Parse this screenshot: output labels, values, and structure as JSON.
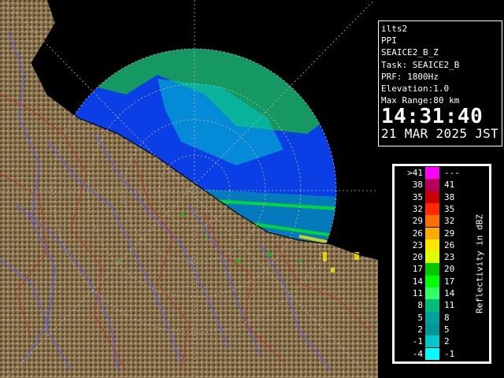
{
  "radar": {
    "station_id": "ilts2",
    "display_mode": "PPI",
    "product": "SEAICE2_B_Z",
    "task_label": "Task: SEAICE2_B",
    "prf_label": "PRF: 1800Hz",
    "elevation_label": "Elevation:1.0",
    "max_range_label": "Max Range:80 km",
    "time": "14:31:40",
    "date": "21 MAR 2025 JST"
  },
  "legend": {
    "title": "Reflectivity in dBZ",
    "rows": [
      {
        "lo": ">41",
        "hi": "---",
        "color": "#ff00ff"
      },
      {
        "lo": "38",
        "hi": "41",
        "color": "#b4005a"
      },
      {
        "lo": "35",
        "hi": "38",
        "color": "#c80000"
      },
      {
        "lo": "32",
        "hi": "35",
        "color": "#ff2800"
      },
      {
        "lo": "29",
        "hi": "32",
        "color": "#ff6e00"
      },
      {
        "lo": "26",
        "hi": "29",
        "color": "#ffaa00"
      },
      {
        "lo": "23",
        "hi": "26",
        "color": "#ffe600"
      },
      {
        "lo": "20",
        "hi": "23",
        "color": "#dcff00"
      },
      {
        "lo": "17",
        "hi": "20",
        "color": "#00c800"
      },
      {
        "lo": "14",
        "hi": "17",
        "color": "#00ff00"
      },
      {
        "lo": "11",
        "hi": "14",
        "color": "#32ff64"
      },
      {
        "lo": "8",
        "hi": "11",
        "color": "#00be7a"
      },
      {
        "lo": "5",
        "hi": "8",
        "color": "#00a0a0"
      },
      {
        "lo": "2",
        "hi": "5",
        "color": "#009696"
      },
      {
        "lo": "-1",
        "hi": "2",
        "color": "#00c8c8"
      },
      {
        "lo": "-4",
        "hi": "-1",
        "color": "#00ffff"
      }
    ]
  },
  "colors": {
    "radar_background": "#0a3fe6",
    "land": "#8a7450",
    "rivers": "#5a5aff",
    "boundaries": "#c03030",
    "range_rings": "#bbbbbb"
  }
}
